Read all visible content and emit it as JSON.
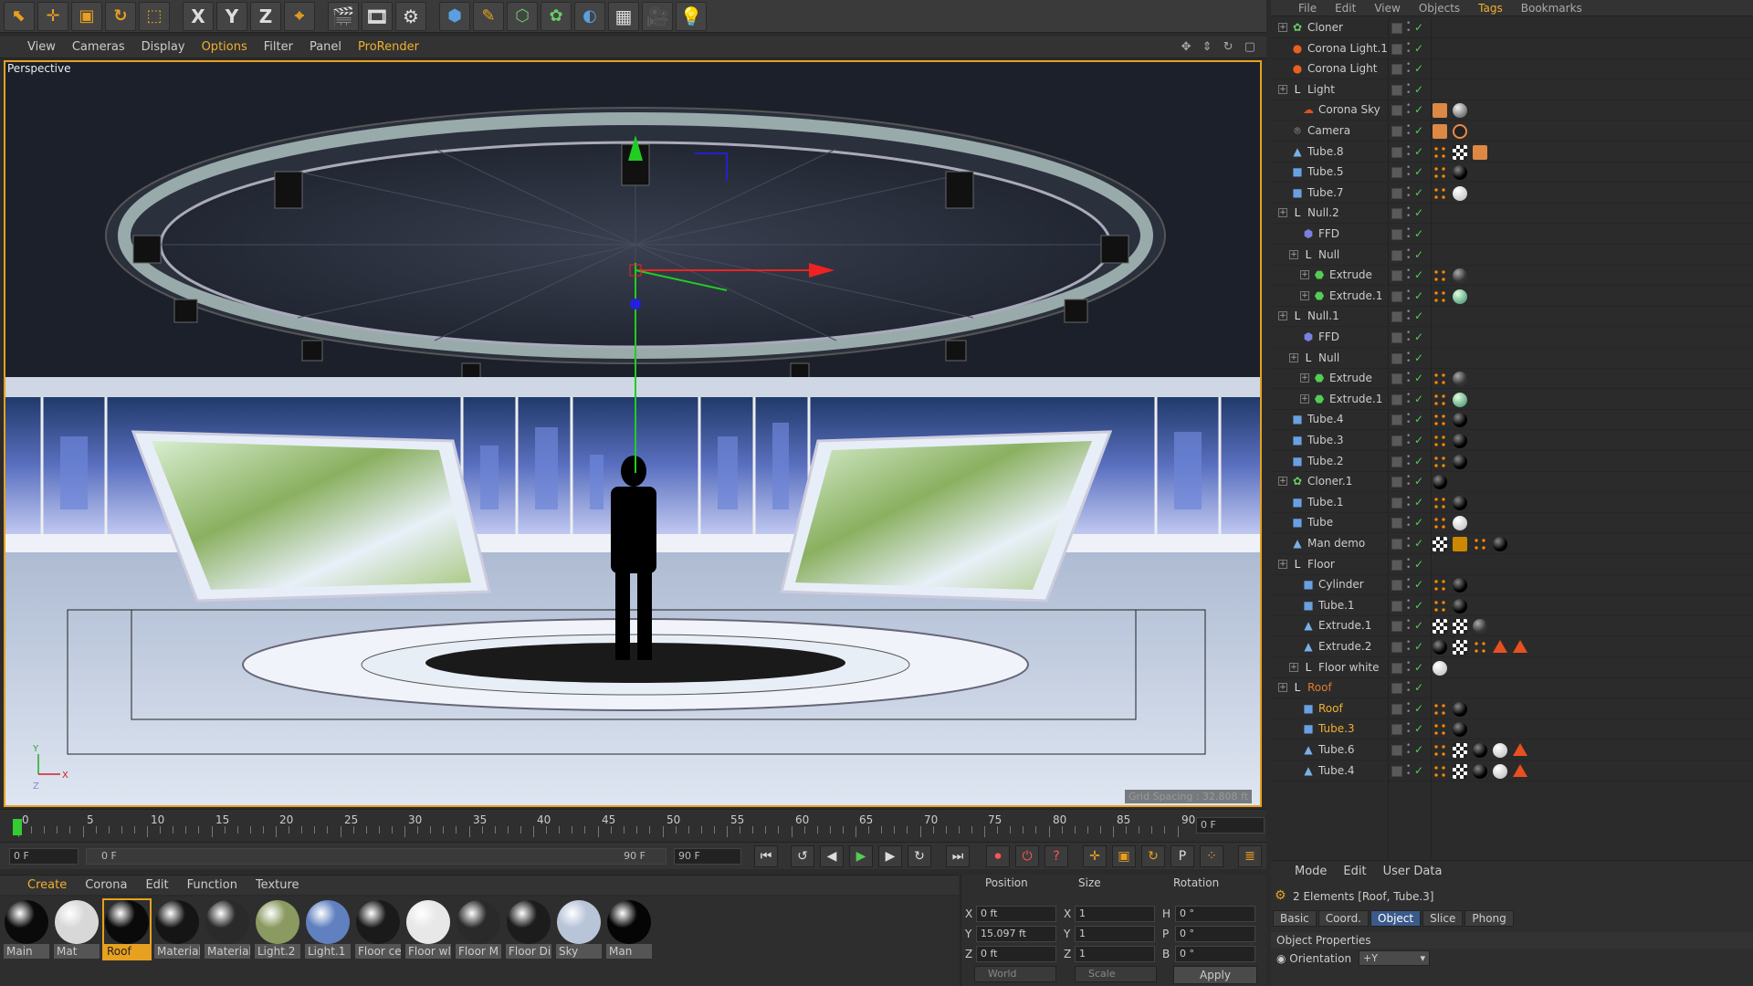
{
  "toolbar": {
    "tools": [
      "move-select",
      "move",
      "scale",
      "rotate",
      "live-select",
      "x-axis",
      "y-axis",
      "z-axis",
      "world-coord",
      "render-view",
      "render-pv",
      "render-settings",
      "cube",
      "pen",
      "subdivision",
      "cloner",
      "deformer",
      "floor-grid",
      "camera",
      "light"
    ],
    "axis_labels": [
      "X",
      "Y",
      "Z"
    ]
  },
  "viewport_menu": {
    "items": [
      "View",
      "Cameras",
      "Display",
      "Options",
      "Filter",
      "Panel",
      "ProRender"
    ],
    "active": "Options"
  },
  "viewport": {
    "label": "Perspective",
    "grid_spacing": "Grid Spacing : 32.808 ft"
  },
  "timeline": {
    "ticks": [
      "0",
      "5",
      "10",
      "15",
      "20",
      "25",
      "30",
      "35",
      "40",
      "45",
      "50",
      "55",
      "60",
      "65",
      "70",
      "75",
      "80",
      "85",
      "90"
    ],
    "current_frame": "0 F"
  },
  "transport": {
    "start_field": "0 F",
    "range_start": "0 F",
    "range_end": "90 F",
    "end_field": "90 F"
  },
  "material_manager": {
    "menu": [
      "Create",
      "Corona",
      "Edit",
      "Function",
      "Texture"
    ],
    "active_menu": "Create",
    "materials": [
      {
        "label": "Main",
        "color": "#0a0a0a"
      },
      {
        "label": "Mat",
        "color": "#d8d8d8"
      },
      {
        "label": "Roof",
        "color": "#0a0a0a",
        "selected": true
      },
      {
        "label": "Material",
        "color": "#151515"
      },
      {
        "label": "Material",
        "color": "#2a2a2a"
      },
      {
        "label": "Light.2",
        "color": "#8a9a60"
      },
      {
        "label": "Light.1",
        "color": "#6080c0"
      },
      {
        "label": "Floor ce",
        "color": "#1a1a1a"
      },
      {
        "label": "Floor wl",
        "color": "#e8e8e8"
      },
      {
        "label": "Floor M",
        "color": "#2a2a2a"
      },
      {
        "label": "Floor Di",
        "color": "#1c1c1c"
      },
      {
        "label": "Sky",
        "color": "#b8c4d8"
      },
      {
        "label": "Man",
        "color": "#050505"
      }
    ]
  },
  "coordinates": {
    "headers": [
      "Position",
      "Size",
      "Rotation"
    ],
    "rows": [
      {
        "pos_axis": "X",
        "pos": "0 ft",
        "size_axis": "X",
        "size": "1",
        "rot_axis": "H",
        "rot": "0 °"
      },
      {
        "pos_axis": "Y",
        "pos": "15.097 ft",
        "size_axis": "Y",
        "size": "1",
        "rot_axis": "P",
        "rot": "0 °"
      },
      {
        "pos_axis": "Z",
        "pos": "0 ft",
        "size_axis": "Z",
        "size": "1",
        "rot_axis": "B",
        "rot": "0 °"
      }
    ],
    "mode_world": "World",
    "mode_scale": "Scale",
    "apply": "Apply"
  },
  "object_manager": {
    "menu": [
      "File",
      "Edit",
      "View",
      "Objects",
      "Tags",
      "Bookmarks"
    ],
    "active_menu": "Tags",
    "objects": [
      {
        "name": "Cloner",
        "depth": 0,
        "icon": "cloner-icon",
        "expand": true,
        "tags": [
          "none"
        ]
      },
      {
        "name": "Corona Light.1",
        "depth": 0,
        "icon": "light-bulb-icon",
        "tags": []
      },
      {
        "name": "Corona Light",
        "depth": 0,
        "icon": "light-bulb-icon",
        "tags": []
      },
      {
        "name": "Light",
        "depth": 0,
        "icon": "null-icon",
        "expand": true,
        "tags": []
      },
      {
        "name": "Corona Sky",
        "depth": 1,
        "icon": "sky-icon",
        "tags": [
          "tex",
          "sphere-grey"
        ]
      },
      {
        "name": "Camera",
        "depth": 0,
        "icon": "camera-icon",
        "tags": [
          "tex",
          "nope"
        ]
      },
      {
        "name": "Tube.8",
        "depth": 0,
        "icon": "poly-icon",
        "tags": [
          "phong",
          "checker",
          "tex"
        ]
      },
      {
        "name": "Tube.5",
        "depth": 0,
        "icon": "tube-icon",
        "tags": [
          "phong",
          "sphere-black"
        ]
      },
      {
        "name": "Tube.7",
        "depth": 0,
        "icon": "tube-icon",
        "tags": [
          "phong",
          "sphere-white"
        ]
      },
      {
        "name": "Null.2",
        "depth": 0,
        "icon": "null-icon",
        "expand": true,
        "tags": []
      },
      {
        "name": "FFD",
        "depth": 1,
        "icon": "ffd-icon",
        "tags": []
      },
      {
        "name": "Null",
        "depth": 1,
        "icon": "null-icon",
        "expand": true,
        "tags": []
      },
      {
        "name": "Extrude",
        "depth": 2,
        "icon": "extrude-icon",
        "expand": true,
        "tags": [
          "phong",
          "sphere-dark"
        ]
      },
      {
        "name": "Extrude.1",
        "depth": 2,
        "icon": "extrude-icon",
        "expand": true,
        "tags": [
          "phong",
          "sphere-green"
        ]
      },
      {
        "name": "Null.1",
        "depth": 0,
        "icon": "null-icon",
        "expand": true,
        "tags": []
      },
      {
        "name": "FFD",
        "depth": 1,
        "icon": "ffd-icon",
        "tags": []
      },
      {
        "name": "Null",
        "depth": 1,
        "icon": "null-icon",
        "expand": true,
        "tags": []
      },
      {
        "name": "Extrude",
        "depth": 2,
        "icon": "extrude-icon",
        "expand": true,
        "tags": [
          "phong",
          "sphere-dark"
        ]
      },
      {
        "name": "Extrude.1",
        "depth": 2,
        "icon": "extrude-icon",
        "expand": true,
        "tags": [
          "phong",
          "sphere-green"
        ]
      },
      {
        "name": "Tube.4",
        "depth": 0,
        "icon": "tube-icon",
        "tags": [
          "phong",
          "sphere-black"
        ]
      },
      {
        "name": "Tube.3",
        "depth": 0,
        "icon": "tube-icon",
        "tags": [
          "phong",
          "sphere-black"
        ]
      },
      {
        "name": "Tube.2",
        "depth": 0,
        "icon": "tube-icon",
        "tags": [
          "phong",
          "sphere-black"
        ]
      },
      {
        "name": "Cloner.1",
        "depth": 0,
        "icon": "cloner-icon",
        "expand": true,
        "tags": [
          "sphere-black"
        ]
      },
      {
        "name": "Tube.1",
        "depth": 0,
        "icon": "tube-icon",
        "tags": [
          "phong",
          "sphere-black"
        ]
      },
      {
        "name": "Tube",
        "depth": 0,
        "icon": "tube-icon",
        "tags": [
          "phong",
          "sphere-white"
        ]
      },
      {
        "name": "Man demo",
        "depth": 0,
        "icon": "poly-icon",
        "tags": [
          "checker",
          "uvw",
          "phong",
          "sphere-black"
        ]
      },
      {
        "name": "Floor",
        "depth": 0,
        "icon": "null-icon",
        "expand": true,
        "tags": []
      },
      {
        "name": "Cylinder",
        "depth": 1,
        "icon": "tube-icon",
        "tags": [
          "phong",
          "sphere-black"
        ]
      },
      {
        "name": "Tube.1",
        "depth": 1,
        "icon": "tube-icon",
        "tags": [
          "phong",
          "sphere-black"
        ]
      },
      {
        "name": "Extrude.1",
        "depth": 1,
        "icon": "poly-icon",
        "tags": [
          "checker",
          "checker",
          "sphere-dark"
        ]
      },
      {
        "name": "Extrude.2",
        "depth": 1,
        "icon": "poly-icon",
        "tags": [
          "sphere-black",
          "checker",
          "phong",
          "triangle",
          "triangle"
        ]
      },
      {
        "name": "Floor white",
        "depth": 1,
        "icon": "null-icon",
        "expand": true,
        "tags": [
          "sphere-white"
        ]
      },
      {
        "name": "Roof",
        "depth": 0,
        "icon": "null-icon",
        "expand": true,
        "style": "roof",
        "tags": []
      },
      {
        "name": "Roof",
        "depth": 1,
        "icon": "tube-icon",
        "style": "hl",
        "tags": [
          "phong",
          "sphere-black"
        ]
      },
      {
        "name": "Tube.3",
        "depth": 1,
        "icon": "tube-icon",
        "style": "hl",
        "tags": [
          "phong",
          "sphere-black"
        ]
      },
      {
        "name": "Tube.6",
        "depth": 1,
        "icon": "poly-icon",
        "tags": [
          "phong",
          "checker",
          "sphere-black",
          "sphere-white",
          "triangle"
        ]
      },
      {
        "name": "Tube.4",
        "depth": 1,
        "icon": "poly-icon",
        "tags": [
          "phong",
          "checker",
          "sphere-black",
          "sphere-white",
          "triangle"
        ]
      }
    ]
  },
  "attribute_manager": {
    "menu": [
      "Mode",
      "Edit",
      "User Data"
    ],
    "selection": "2 Elements [Roof, Tube.3]",
    "tabs": [
      "Basic",
      "Coord.",
      "Object",
      "Slice",
      "Phong"
    ],
    "active_tab": "Object",
    "section": "Object Properties",
    "orientation_label": "Orientation",
    "orientation_value": "+Y"
  },
  "colors": {
    "accent": "#e8a020",
    "active_tab": "#3a5a8a"
  }
}
